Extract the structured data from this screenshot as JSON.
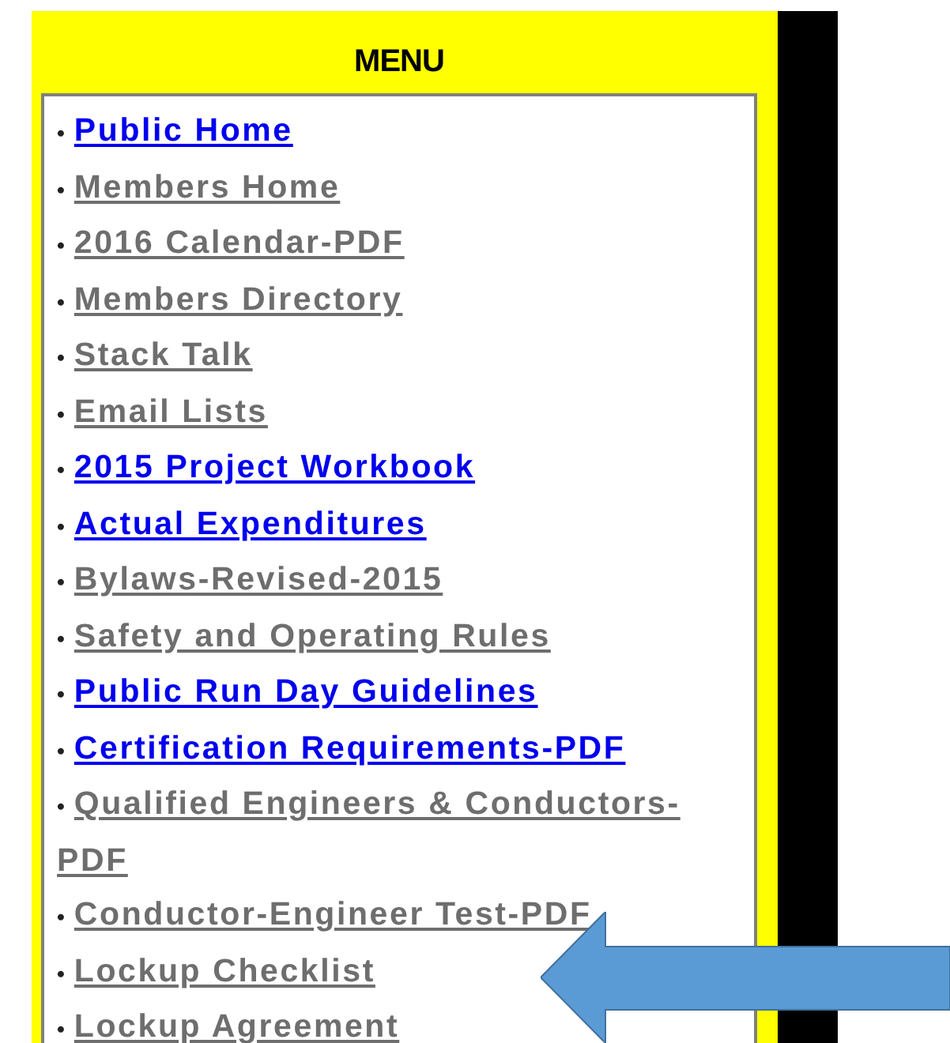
{
  "menu": {
    "title": "MENU",
    "bullet": "•",
    "items": [
      {
        "label": "Public Home",
        "visited": false
      },
      {
        "label": "Members Home",
        "visited": true
      },
      {
        "label": "2016 Calendar-PDF",
        "visited": true
      },
      {
        "label": "Members Directory",
        "visited": true
      },
      {
        "label": "Stack Talk",
        "visited": true
      },
      {
        "label": "Email Lists",
        "visited": true
      },
      {
        "label": "2015 Project Workbook",
        "visited": false
      },
      {
        "label": "Actual Expenditures",
        "visited": false
      },
      {
        "label": "Bylaws-Revised-2015",
        "visited": true
      },
      {
        "label": "Safety and Operating Rules",
        "visited": true
      },
      {
        "label": "Public Run Day Guidelines",
        "visited": false
      },
      {
        "label": "Certification Requirements-PDF",
        "visited": false
      },
      {
        "label": "Qualified Engineers & Conductors-PDF",
        "visited": true
      },
      {
        "label": "Conductor-Engineer Test-PDF",
        "visited": true
      },
      {
        "label": "Lockup Checklist",
        "visited": true
      },
      {
        "label": "Lockup Agreement",
        "visited": true
      }
    ]
  }
}
